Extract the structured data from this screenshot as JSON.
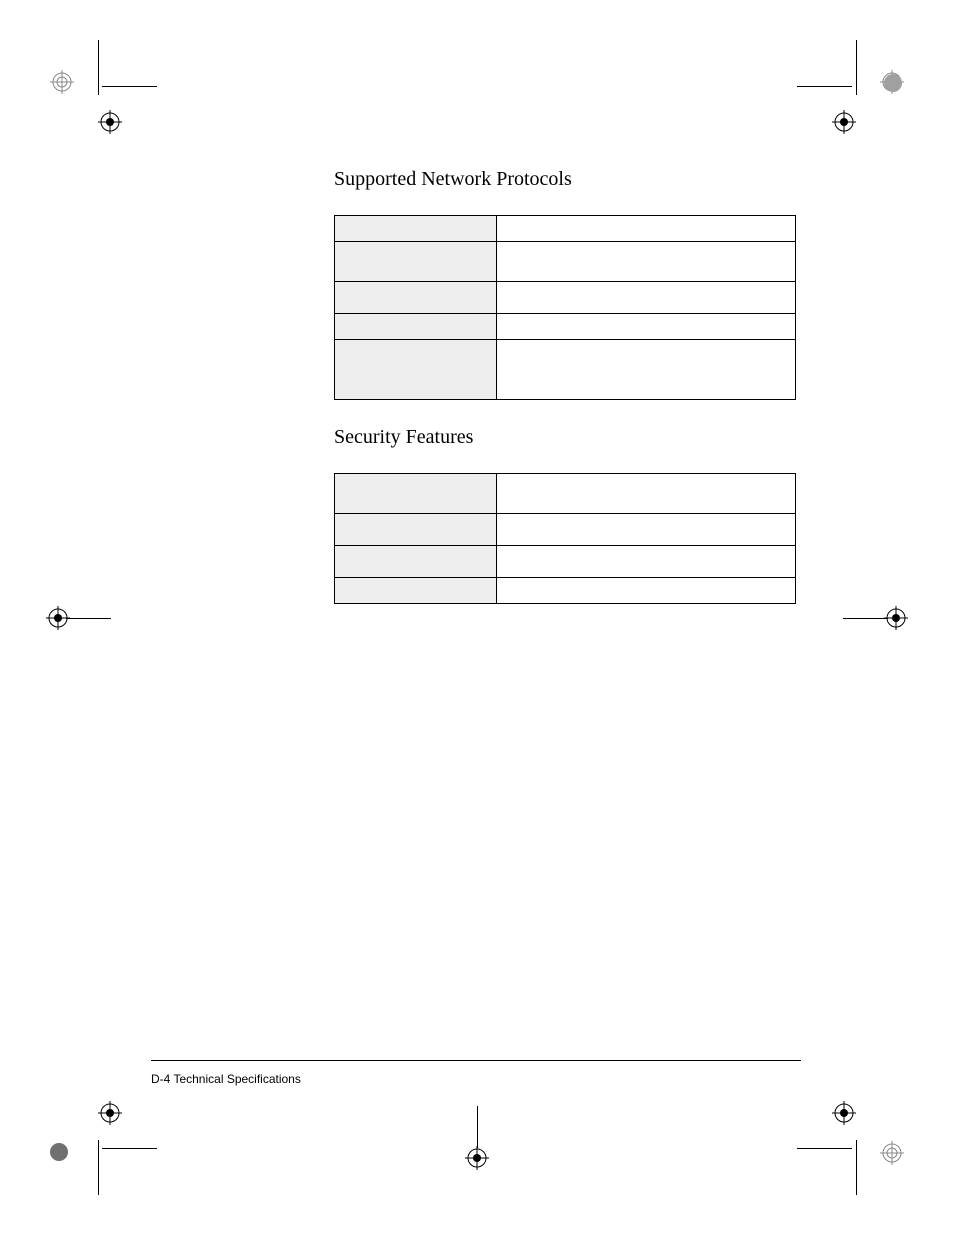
{
  "sections": {
    "protocols": {
      "heading": "Supported Network Protocols",
      "rows": [
        {
          "label": "",
          "value": ""
        },
        {
          "label": "",
          "value": ""
        },
        {
          "label": "",
          "value": ""
        },
        {
          "label": "",
          "value": ""
        },
        {
          "label": "",
          "value": ""
        }
      ]
    },
    "security": {
      "heading": "Security Features",
      "rows": [
        {
          "label": "",
          "value": ""
        },
        {
          "label": "",
          "value": ""
        },
        {
          "label": "",
          "value": ""
        },
        {
          "label": "",
          "value": ""
        }
      ]
    }
  },
  "footer": "D-4 Technical Specifications",
  "row_heights": {
    "protocols": [
      26,
      40,
      32,
      26,
      60
    ],
    "security": [
      40,
      32,
      32,
      26
    ]
  }
}
